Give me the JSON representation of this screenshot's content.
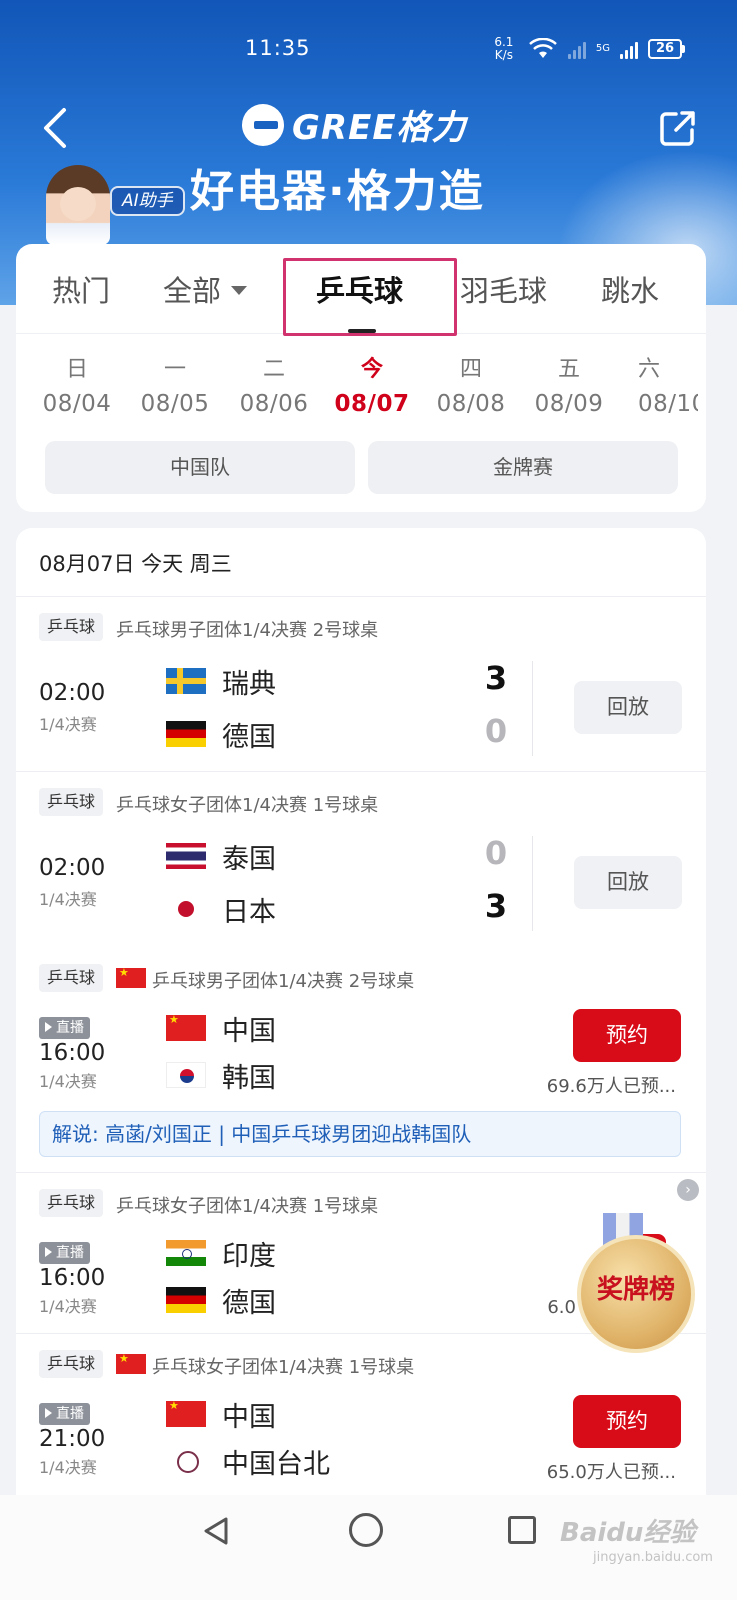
{
  "status_bar": {
    "time": "11:35",
    "net_speed_value": "6.1",
    "net_speed_unit": "K/s",
    "signal_label": "5G",
    "battery": "26"
  },
  "header": {
    "logo_text": "GREE格力",
    "slogan": "好电器·格力造",
    "ai_badge": "AI助手",
    "colors": {
      "primary": "#1156b8",
      "accent": "#d80c18"
    }
  },
  "sport_tabs": [
    {
      "label": "热门"
    },
    {
      "label": "全部",
      "has_dropdown": true
    },
    {
      "label": "乒乓球",
      "active": true
    },
    {
      "label": "羽毛球"
    },
    {
      "label": "跳水"
    }
  ],
  "days": [
    {
      "weekday": "日",
      "date": "08/04"
    },
    {
      "weekday": "一",
      "date": "08/05"
    },
    {
      "weekday": "二",
      "date": "08/06"
    },
    {
      "weekday": "今",
      "date": "08/07",
      "today": true
    },
    {
      "weekday": "四",
      "date": "08/08"
    },
    {
      "weekday": "五",
      "date": "08/09"
    },
    {
      "weekday": "六",
      "date": "08/10"
    }
  ],
  "filter_chips": [
    "中国队",
    "金牌赛"
  ],
  "schedule": {
    "date_header": "08月07日 今天 周三",
    "matches": [
      {
        "tag": "乒乓球",
        "title": "乒乓球男子团体1/4决赛 2号球桌",
        "time": "02:00",
        "round": "1/4决赛",
        "team1": {
          "name": "瑞典",
          "flag": "sweden-flag",
          "score": "3"
        },
        "team2": {
          "name": "德国",
          "flag": "germany-flag",
          "score": "0"
        },
        "action": "回放"
      },
      {
        "tag": "乒乓球",
        "title": "乒乓球女子团体1/4决赛 1号球桌",
        "time": "02:00",
        "round": "1/4决赛",
        "team1": {
          "name": "泰国",
          "flag": "thailand-flag",
          "score": "0"
        },
        "team2": {
          "name": "日本",
          "flag": "japan-flag",
          "score": "3"
        },
        "action": "回放"
      },
      {
        "tag": "乒乓球",
        "title": "乒乓球男子团体1/4决赛 2号球桌",
        "live_label": "直播",
        "time": "16:00",
        "round": "1/4决赛",
        "team1": {
          "name": "中国",
          "flag": "china-flag"
        },
        "team2": {
          "name": "韩国",
          "flag": "korea-flag"
        },
        "action": "预约",
        "reserve_count": "69.6万人已预...",
        "commentary": "解说: 高菡/刘国正 | 中国乒乓球男团迎战韩国队"
      },
      {
        "tag": "乒乓球",
        "title": "乒乓球女子团体1/4决赛 1号球桌",
        "live_label": "直播",
        "time": "16:00",
        "round": "1/4决赛",
        "team1": {
          "name": "印度",
          "flag": "india-flag"
        },
        "team2": {
          "name": "德国",
          "flag": "germany-flag"
        },
        "reserve_count": "6.0"
      },
      {
        "tag": "乒乓球",
        "title": "乒乓球女子团体1/4决赛 1号球桌",
        "live_label": "直播",
        "time": "21:00",
        "round": "1/4决赛",
        "team1": {
          "name": "中国",
          "flag": "china-flag"
        },
        "team2": {
          "name": "中国台北",
          "flag": "chinese-taipei-flag"
        },
        "action": "预约",
        "reserve_count": "65.0万人已预..."
      }
    ]
  },
  "medal_badge": {
    "label": "奖牌榜"
  },
  "watermark": {
    "text": "Baidu经验",
    "sub": "jingyan.baidu.com"
  }
}
